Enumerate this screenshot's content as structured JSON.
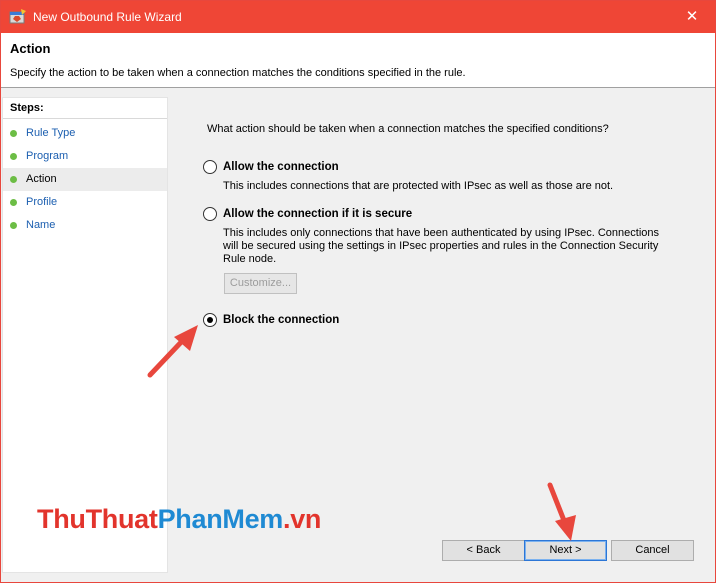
{
  "window": {
    "title": "New Outbound Rule Wizard",
    "close_glyph": "✕",
    "accent_color": "#ef4636",
    "icon": "firewall-wizard-icon"
  },
  "header": {
    "title": "Action",
    "description": "Specify the action to be taken when a connection matches the conditions specified in the rule."
  },
  "steps": {
    "title": "Steps:",
    "items": [
      {
        "label": "Rule Type",
        "current": false
      },
      {
        "label": "Program",
        "current": false
      },
      {
        "label": "Action",
        "current": true
      },
      {
        "label": "Profile",
        "current": false
      },
      {
        "label": "Name",
        "current": false
      }
    ]
  },
  "main": {
    "question": "What action should be taken when a connection matches the specified conditions?",
    "options": [
      {
        "label": "Allow the connection",
        "description": "This includes connections that are protected with IPsec as well as those are not.",
        "selected": false
      },
      {
        "label": "Allow the connection if it is secure",
        "description": "This includes only connections that have been authenticated by using IPsec.  Connections will be secured using the settings in IPsec properties and rules in the Connection Security Rule node.",
        "selected": false
      },
      {
        "label": "Block the connection",
        "description": "",
        "selected": true
      }
    ],
    "customize_label": "Customize..."
  },
  "buttons": {
    "back": "< Back",
    "next": "Next >",
    "cancel": "Cancel"
  },
  "watermark": {
    "part1": "ThuThuat",
    "part2": "PhanMem",
    "part3": ".vn"
  }
}
